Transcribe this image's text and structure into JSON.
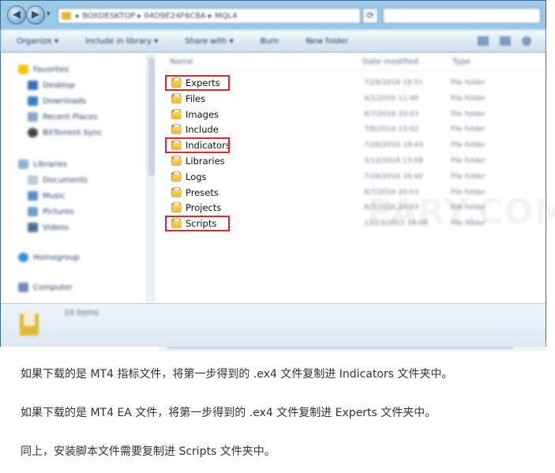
{
  "window": {
    "address_path": "▸ BOXDESKTOP ▸ 04D9E24F6C8A ▸ MQL4",
    "refresh_glyph": "⟳",
    "back_glyph": "◀",
    "forward_glyph": "▶",
    "recent_glyph": "▾"
  },
  "toolbar": {
    "organize": "Organize ▾",
    "include_in_library": "Include in library ▾",
    "share_with": "Share with ▾",
    "burn": "Burn",
    "new_folder": "New folder"
  },
  "nav": {
    "favorites": "Favorites",
    "desktop": "Desktop",
    "downloads": "Downloads",
    "recent_places": "Recent Places",
    "bittorrent_sync": "BitTorrent Sync",
    "libraries": "Libraries",
    "documents": "Documents",
    "music": "Music",
    "pictures": "Pictures",
    "videos": "Videos",
    "homegroup": "Homegroup",
    "computer": "Computer"
  },
  "columns": {
    "name": "Name",
    "date_modified": "Date modified",
    "type": "Type"
  },
  "files": [
    {
      "name": "Experts",
      "date": "7/28/2016 18:51",
      "type": "File folder",
      "highlighted": true
    },
    {
      "name": "Files",
      "date": "4/1/2016 11:48",
      "type": "File folder",
      "highlighted": false
    },
    {
      "name": "Images",
      "date": "8/7/2016 20:03",
      "type": "File folder",
      "highlighted": false
    },
    {
      "name": "Include",
      "date": "7/8/2016 23:02",
      "type": "File folder",
      "highlighted": false
    },
    {
      "name": "Indicators",
      "date": "7/28/2016 18:43",
      "type": "File folder",
      "highlighted": true
    },
    {
      "name": "Libraries",
      "date": "3/12/2016 13:08",
      "type": "File folder",
      "highlighted": false
    },
    {
      "name": "Logs",
      "date": "7/28/2016 16:40",
      "type": "File folder",
      "highlighted": false
    },
    {
      "name": "Presets",
      "date": "8/7/2016 20:03",
      "type": "File folder",
      "highlighted": false
    },
    {
      "name": "Projects",
      "date": "8/7/2016 20:03",
      "type": "File folder",
      "highlighted": false
    },
    {
      "name": "Scripts",
      "date": "12/23/2015 16:08",
      "type": "File folder",
      "highlighted": true
    }
  ],
  "watermark": "PARY.COM",
  "details": {
    "item_count": "10 items"
  },
  "captions": [
    "如果下载的是 MT4 指标文件，将第一步得到的 .ex4 文件复制进 Indicators 文件夹中。",
    "如果下载的是 MT4 EA 文件，将第一步得到的 .ex4 文件复制进 Experts 文件夹中。",
    "同上，安装脚本文件需要复制进 Scripts 文件夹中。"
  ],
  "colors": {
    "highlight_border": "#e2262b",
    "folder": "#e6b83a",
    "window_frame": "#7fb6de"
  }
}
